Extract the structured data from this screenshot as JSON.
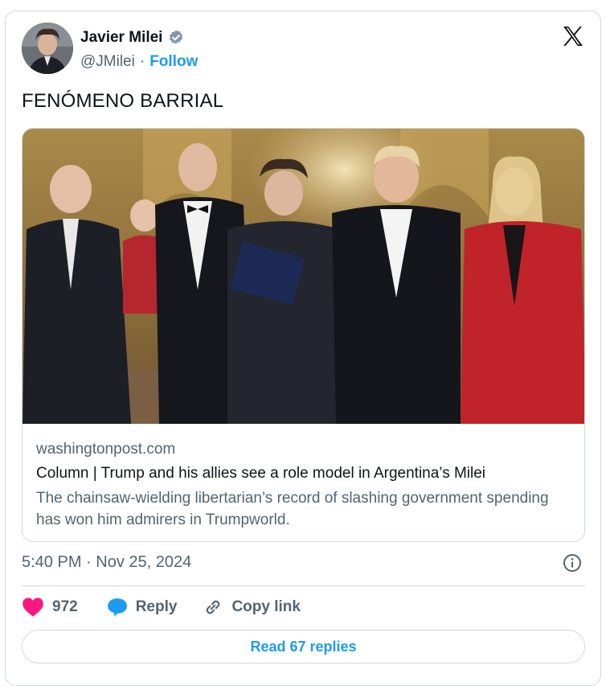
{
  "author": {
    "name": "Javier Milei",
    "handle": "@JMilei",
    "separator": "·",
    "follow_label": "Follow",
    "verified": true
  },
  "tweet": {
    "text": "FENÓMENO BARRIAL",
    "timestamp": "5:40 PM · Nov 25, 2024"
  },
  "link_card": {
    "domain": "washingtonpost.com",
    "headline": "Column | Trump and his allies see a role model in Argentina’s Milei",
    "description": "The chainsaw-wielding libertarian’s record of slashing government spending has won him admirers in Trumpworld."
  },
  "actions": {
    "like_count": "972",
    "reply_label": "Reply",
    "copy_label": "Copy link"
  },
  "read_replies_label": "Read 67 replies",
  "colors": {
    "accent": "#1d9bf0",
    "like": "#f91880",
    "muted_text": "#536471",
    "border": "#cfd9de"
  },
  "icons": [
    "verified-badge-icon",
    "x-logo-icon",
    "info-icon",
    "heart-icon",
    "reply-bubble-icon",
    "link-icon"
  ]
}
